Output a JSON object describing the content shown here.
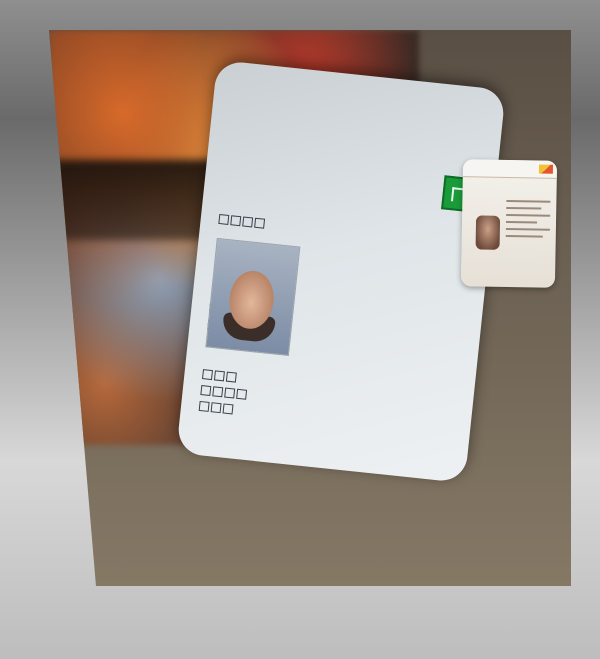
{
  "scene": {
    "description_colors": {
      "background_gradient_top": "#8f8f8f",
      "background_gradient_bottom": "#bdbdbd",
      "card_base": "#eef1f3",
      "emblem_green": "#1a9b3a",
      "text_navy": "#1d2b4d"
    }
  },
  "main_card": {
    "title": "",
    "subtitle": "",
    "rows": [
      {
        "label": ""
      },
      {
        "label": ""
      },
      {
        "label": ""
      },
      {
        "label": ""
      },
      {
        "label": ""
      },
      {
        "label": ""
      }
    ]
  },
  "small_card": {
    "header": ""
  }
}
